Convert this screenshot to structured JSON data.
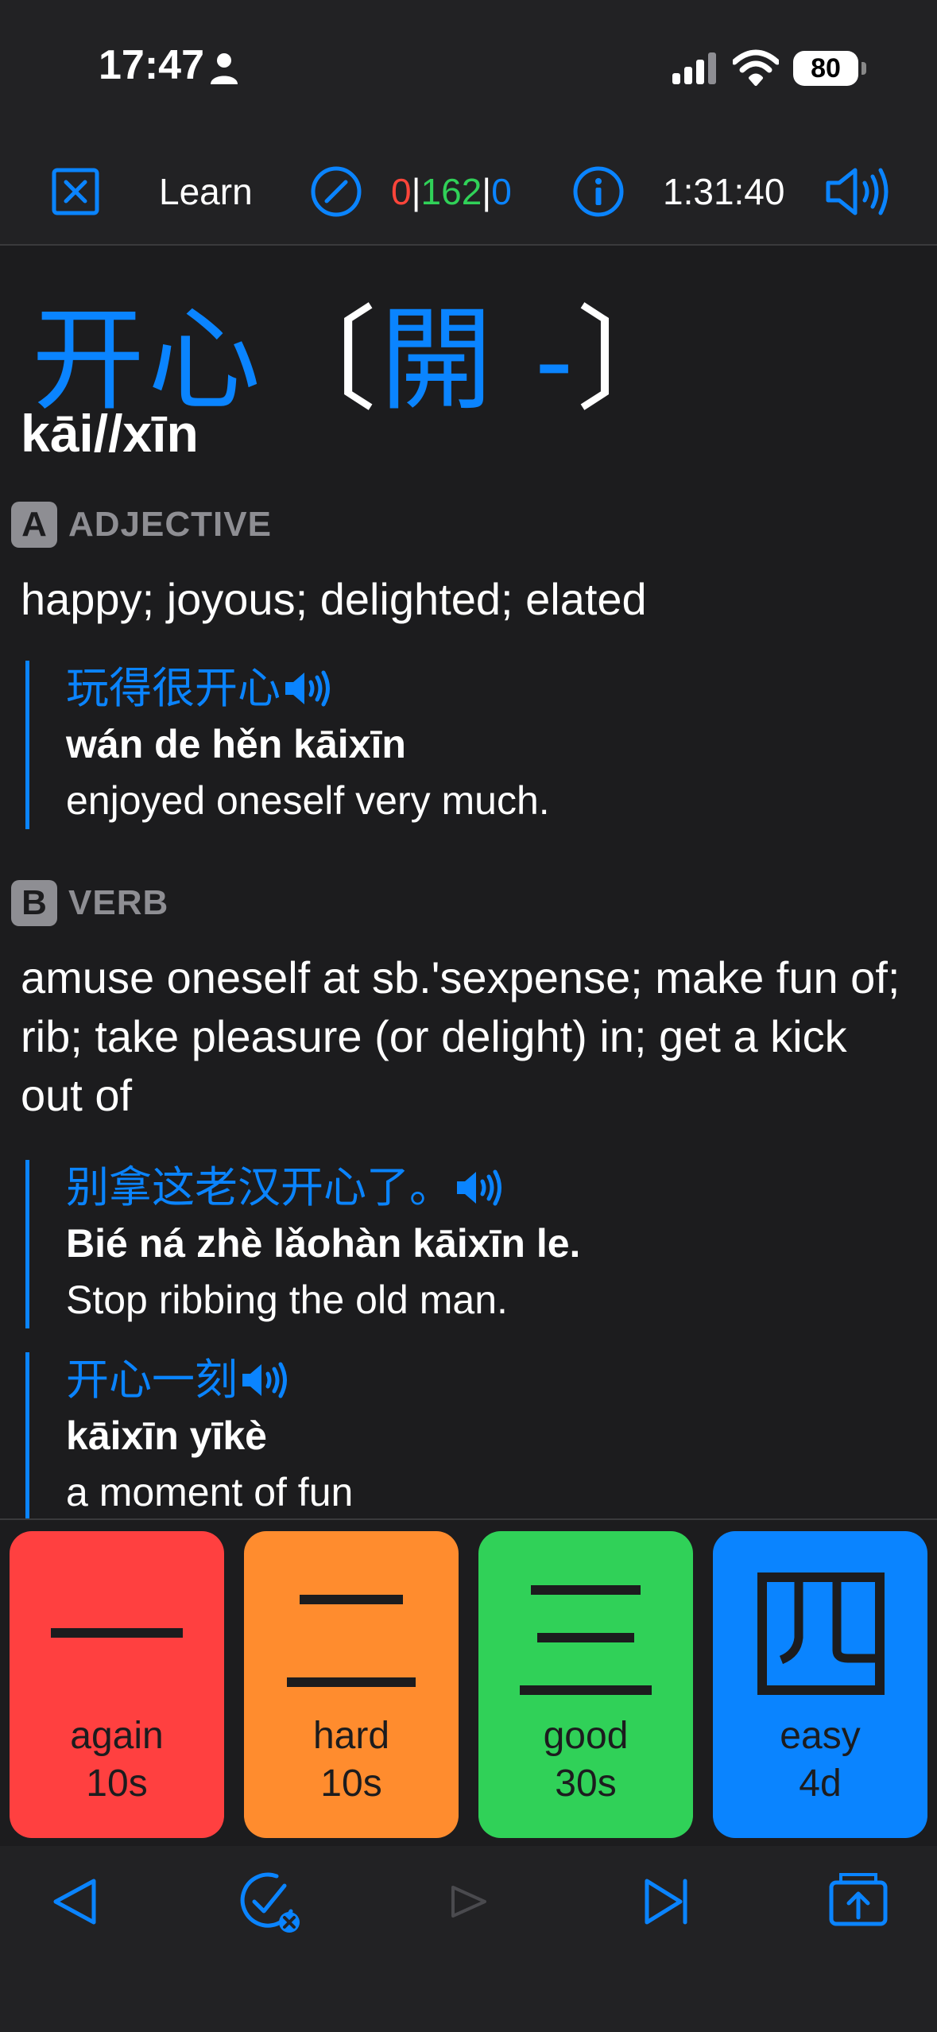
{
  "status_bar": {
    "time": "17:47",
    "battery": "80"
  },
  "toolbar": {
    "title": "Learn",
    "count_red": "0",
    "count_green": "162",
    "count_blue": "0",
    "sep": "|",
    "timer": "1:31:40"
  },
  "entry": {
    "headword": "开心",
    "traditional": "開 -",
    "pinyin": "kāi//xīn",
    "senses": [
      {
        "badge": "A",
        "pos": "ADJECTIVE",
        "definition": "happy; joyous; delighted; elated",
        "examples": [
          {
            "cn": "玩得很开心",
            "py": "wán de hěn kāixīn",
            "en": "enjoyed oneself very much."
          }
        ]
      },
      {
        "badge": "B",
        "pos": "VERB",
        "definition": "amuse oneself at sb.'sexpense; make fun of; rib; take pleasure (or delight) in; get a kick out of",
        "examples": [
          {
            "cn": "别拿这老汉开心了。",
            "py": "Bié ná zhè lǎohàn kāixīn le.",
            "en": "Stop ribbing the old man."
          },
          {
            "cn": "开心一刻",
            "py": "kāixīn yīkè",
            "en": "a moment of fun"
          }
        ]
      }
    ]
  },
  "rating_buttons": [
    {
      "label": "again",
      "interval": "10s",
      "color": "#ff4040"
    },
    {
      "label": "hard",
      "interval": "10s",
      "color": "#ff8c2e"
    },
    {
      "label": "good",
      "interval": "30s",
      "color": "#30d158"
    },
    {
      "label": "easy",
      "interval": "4d",
      "color": "#0a84ff"
    }
  ],
  "colors": {
    "accent": "#0a84ff",
    "background": "#1c1c1e",
    "bar": "#222224"
  },
  "icons": {
    "toolbar": [
      "close-icon",
      "edit-icon",
      "info-icon",
      "speaker-icon"
    ],
    "bottom_nav": [
      "back-icon",
      "mark-known-icon",
      "play-icon",
      "skip-forward-icon",
      "share-icon"
    ]
  }
}
